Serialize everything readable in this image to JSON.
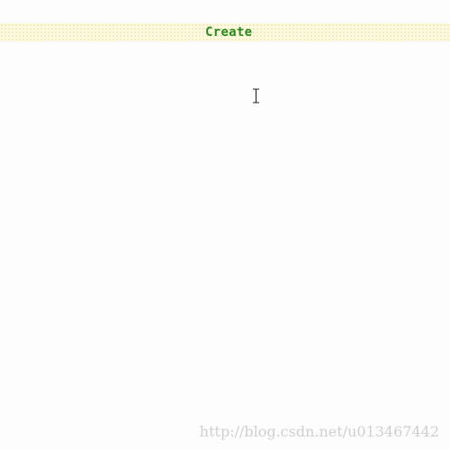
{
  "toolbar": {
    "create_label": "Create"
  },
  "cursor": {
    "icon": "text-cursor-icon"
  },
  "watermark": {
    "text": "http://blog.csdn.net/u013467442"
  },
  "colors": {
    "bar_background": "#fbf8dc",
    "create_text": "#2a8a1e",
    "page_background": "#fdfdfd",
    "watermark_text": "#cfcfcf"
  }
}
